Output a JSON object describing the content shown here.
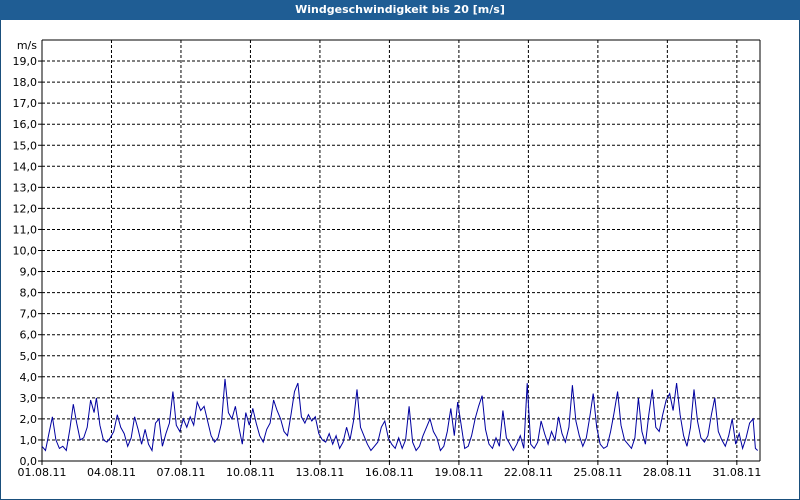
{
  "window": {
    "title": "Windgeschwindigkeit bis 20 [m/s]"
  },
  "chart_data": {
    "type": "line",
    "title": "Windgeschwindigkeit bis 20 [m/s]",
    "ylabel": "m/s",
    "ylim": [
      0,
      20
    ],
    "xlim": [
      1,
      32
    ],
    "grid": true,
    "yticks": [
      "0,0",
      "1,0",
      "2,0",
      "3,0",
      "4,0",
      "5,0",
      "6,0",
      "7,0",
      "8,0",
      "9,0",
      "10,0",
      "11,0",
      "12,0",
      "13,0",
      "14,0",
      "15,0",
      "16,0",
      "17,0",
      "18,0",
      "19,0"
    ],
    "xticks": [
      {
        "label": "01.08.11",
        "day": 1
      },
      {
        "label": "04.08.11",
        "day": 4
      },
      {
        "label": "07.08.11",
        "day": 7
      },
      {
        "label": "10.08.11",
        "day": 10
      },
      {
        "label": "13.08.11",
        "day": 13
      },
      {
        "label": "16.08.11",
        "day": 16
      },
      {
        "label": "19.08.11",
        "day": 19
      },
      {
        "label": "22.08.11",
        "day": 22
      },
      {
        "label": "25.08.11",
        "day": 25
      },
      {
        "label": "28.08.11",
        "day": 28
      },
      {
        "label": "31.08.11",
        "day": 31
      }
    ],
    "series": [
      {
        "color": "#0000a0",
        "points": [
          [
            1.0,
            0.7
          ],
          [
            1.15,
            0.5
          ],
          [
            1.3,
            1.3
          ],
          [
            1.45,
            2.1
          ],
          [
            1.6,
            1.0
          ],
          [
            1.75,
            0.6
          ],
          [
            1.9,
            0.7
          ],
          [
            2.05,
            0.5
          ],
          [
            2.2,
            1.5
          ],
          [
            2.35,
            2.7
          ],
          [
            2.5,
            1.8
          ],
          [
            2.65,
            1.0
          ],
          [
            2.8,
            1.1
          ],
          [
            2.95,
            1.6
          ],
          [
            3.1,
            2.9
          ],
          [
            3.25,
            2.3
          ],
          [
            3.35,
            3.0
          ],
          [
            3.5,
            1.7
          ],
          [
            3.65,
            1.0
          ],
          [
            3.8,
            0.9
          ],
          [
            3.95,
            1.1
          ],
          [
            4.1,
            1.4
          ],
          [
            4.25,
            2.2
          ],
          [
            4.4,
            1.6
          ],
          [
            4.55,
            1.3
          ],
          [
            4.7,
            0.7
          ],
          [
            4.85,
            1.1
          ],
          [
            5.0,
            2.1
          ],
          [
            5.15,
            1.5
          ],
          [
            5.3,
            0.8
          ],
          [
            5.45,
            1.5
          ],
          [
            5.6,
            0.8
          ],
          [
            5.75,
            0.5
          ],
          [
            5.9,
            1.8
          ],
          [
            6.05,
            2.0
          ],
          [
            6.2,
            0.7
          ],
          [
            6.35,
            1.3
          ],
          [
            6.5,
            1.8
          ],
          [
            6.65,
            3.3
          ],
          [
            6.8,
            1.7
          ],
          [
            6.95,
            1.4
          ],
          [
            7.1,
            2.0
          ],
          [
            7.25,
            1.6
          ],
          [
            7.4,
            2.1
          ],
          [
            7.55,
            1.7
          ],
          [
            7.7,
            2.8
          ],
          [
            7.85,
            2.4
          ],
          [
            8.0,
            2.6
          ],
          [
            8.15,
            1.9
          ],
          [
            8.3,
            1.2
          ],
          [
            8.45,
            0.9
          ],
          [
            8.6,
            1.1
          ],
          [
            8.75,
            1.8
          ],
          [
            8.9,
            3.9
          ],
          [
            9.05,
            2.3
          ],
          [
            9.2,
            2.0
          ],
          [
            9.35,
            2.6
          ],
          [
            9.5,
            1.6
          ],
          [
            9.65,
            0.8
          ],
          [
            9.8,
            2.3
          ],
          [
            9.95,
            1.7
          ],
          [
            10.1,
            2.5
          ],
          [
            10.25,
            1.8
          ],
          [
            10.4,
            1.2
          ],
          [
            10.55,
            0.9
          ],
          [
            10.7,
            1.5
          ],
          [
            10.85,
            1.8
          ],
          [
            11.0,
            2.9
          ],
          [
            11.15,
            2.4
          ],
          [
            11.3,
            2.0
          ],
          [
            11.45,
            1.4
          ],
          [
            11.6,
            1.2
          ],
          [
            11.75,
            2.2
          ],
          [
            11.9,
            3.3
          ],
          [
            12.05,
            3.7
          ],
          [
            12.2,
            2.1
          ],
          [
            12.35,
            1.8
          ],
          [
            12.5,
            2.2
          ],
          [
            12.65,
            1.9
          ],
          [
            12.8,
            2.1
          ],
          [
            12.95,
            1.3
          ],
          [
            13.1,
            1.0
          ],
          [
            13.25,
            0.9
          ],
          [
            13.4,
            1.3
          ],
          [
            13.55,
            0.8
          ],
          [
            13.7,
            1.2
          ],
          [
            13.85,
            0.6
          ],
          [
            14.0,
            0.9
          ],
          [
            14.15,
            1.6
          ],
          [
            14.3,
            1.0
          ],
          [
            14.45,
            1.9
          ],
          [
            14.6,
            3.4
          ],
          [
            14.75,
            1.6
          ],
          [
            14.9,
            1.2
          ],
          [
            15.05,
            0.8
          ],
          [
            15.2,
            0.5
          ],
          [
            15.35,
            0.7
          ],
          [
            15.5,
            0.9
          ],
          [
            15.65,
            1.6
          ],
          [
            15.8,
            1.9
          ],
          [
            15.95,
            1.1
          ],
          [
            16.1,
            0.8
          ],
          [
            16.25,
            0.6
          ],
          [
            16.4,
            1.1
          ],
          [
            16.55,
            0.6
          ],
          [
            16.7,
            1.0
          ],
          [
            16.85,
            2.6
          ],
          [
            17.0,
            0.9
          ],
          [
            17.15,
            0.5
          ],
          [
            17.3,
            0.7
          ],
          [
            17.45,
            1.2
          ],
          [
            17.6,
            1.6
          ],
          [
            17.75,
            2.0
          ],
          [
            17.9,
            1.4
          ],
          [
            18.05,
            1.1
          ],
          [
            18.2,
            0.5
          ],
          [
            18.35,
            0.7
          ],
          [
            18.5,
            1.4
          ],
          [
            18.65,
            2.5
          ],
          [
            18.8,
            1.2
          ],
          [
            18.95,
            2.8
          ],
          [
            19.1,
            1.7
          ],
          [
            19.25,
            0.6
          ],
          [
            19.4,
            0.7
          ],
          [
            19.55,
            1.2
          ],
          [
            19.7,
            2.0
          ],
          [
            19.85,
            2.6
          ],
          [
            20.0,
            3.1
          ],
          [
            20.15,
            1.5
          ],
          [
            20.3,
            0.8
          ],
          [
            20.45,
            0.6
          ],
          [
            20.6,
            1.1
          ],
          [
            20.75,
            0.7
          ],
          [
            20.9,
            2.4
          ],
          [
            21.05,
            1.1
          ],
          [
            21.2,
            0.8
          ],
          [
            21.35,
            0.5
          ],
          [
            21.5,
            0.8
          ],
          [
            21.65,
            1.2
          ],
          [
            21.8,
            0.6
          ],
          [
            21.95,
            3.7
          ],
          [
            22.1,
            0.8
          ],
          [
            22.25,
            0.6
          ],
          [
            22.4,
            0.9
          ],
          [
            22.55,
            1.9
          ],
          [
            22.7,
            1.3
          ],
          [
            22.85,
            0.8
          ],
          [
            23.0,
            1.4
          ],
          [
            23.15,
            1.0
          ],
          [
            23.3,
            2.1
          ],
          [
            23.45,
            1.3
          ],
          [
            23.6,
            0.9
          ],
          [
            23.75,
            1.6
          ],
          [
            23.9,
            3.6
          ],
          [
            24.05,
            1.9
          ],
          [
            24.2,
            1.2
          ],
          [
            24.35,
            0.7
          ],
          [
            24.5,
            1.1
          ],
          [
            24.65,
            2.1
          ],
          [
            24.8,
            3.2
          ],
          [
            24.95,
            1.6
          ],
          [
            25.1,
            0.8
          ],
          [
            25.25,
            0.6
          ],
          [
            25.4,
            0.7
          ],
          [
            25.55,
            1.4
          ],
          [
            25.7,
            2.3
          ],
          [
            25.85,
            3.3
          ],
          [
            26.0,
            1.7
          ],
          [
            26.15,
            1.0
          ],
          [
            26.3,
            0.8
          ],
          [
            26.45,
            0.6
          ],
          [
            26.6,
            1.1
          ],
          [
            26.75,
            3.0
          ],
          [
            26.9,
            1.4
          ],
          [
            27.05,
            0.8
          ],
          [
            27.2,
            2.2
          ],
          [
            27.35,
            3.4
          ],
          [
            27.5,
            1.6
          ],
          [
            27.65,
            1.4
          ],
          [
            27.8,
            2.2
          ],
          [
            27.95,
            2.9
          ],
          [
            28.1,
            3.2
          ],
          [
            28.25,
            2.4
          ],
          [
            28.4,
            3.7
          ],
          [
            28.55,
            2.2
          ],
          [
            28.7,
            1.2
          ],
          [
            28.85,
            0.7
          ],
          [
            29.0,
            1.6
          ],
          [
            29.15,
            3.4
          ],
          [
            29.3,
            1.9
          ],
          [
            29.45,
            1.1
          ],
          [
            29.6,
            0.9
          ],
          [
            29.75,
            1.2
          ],
          [
            29.9,
            2.2
          ],
          [
            30.05,
            3.0
          ],
          [
            30.2,
            1.4
          ],
          [
            30.35,
            1.0
          ],
          [
            30.5,
            0.7
          ],
          [
            30.65,
            1.2
          ],
          [
            30.8,
            2.0
          ],
          [
            30.95,
            0.8
          ],
          [
            31.1,
            1.3
          ],
          [
            31.25,
            0.6
          ],
          [
            31.4,
            1.1
          ],
          [
            31.55,
            1.8
          ],
          [
            31.7,
            2.0
          ],
          [
            31.8,
            0.6
          ],
          [
            31.9,
            0.5
          ]
        ]
      }
    ]
  }
}
